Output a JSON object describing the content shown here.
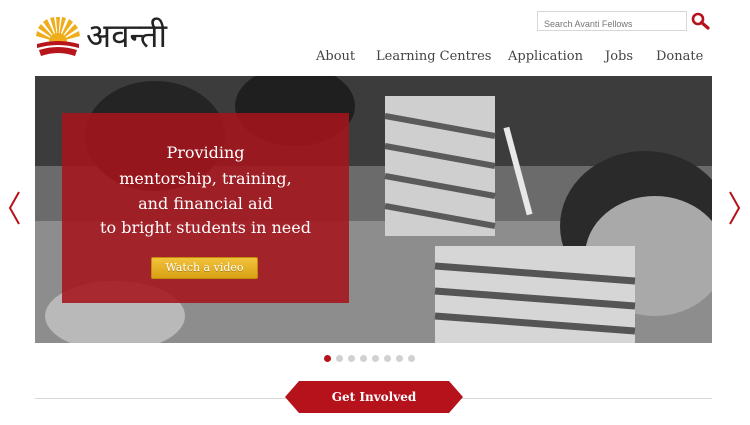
{
  "brand": {
    "name": "अवन्ती"
  },
  "search": {
    "placeholder": "Search Avanti Fellows",
    "icon": "search-icon"
  },
  "nav": {
    "items": [
      {
        "label": "About"
      },
      {
        "label": "Learning Centres"
      },
      {
        "label": "Application"
      },
      {
        "label": "Jobs"
      },
      {
        "label": "Donate"
      }
    ]
  },
  "hero": {
    "caption_lines": [
      "Providing",
      "mentorship, training,",
      "and financial aid",
      "to bright students in need"
    ],
    "cta_label": "Watch a video",
    "prev_icon": "chevron-left-icon",
    "next_icon": "chevron-right-icon"
  },
  "carousel": {
    "slide_count": 8,
    "active_index": 0
  },
  "section": {
    "label": "Get Involved"
  },
  "colors": {
    "brand_red": "#a5161c",
    "gold": "#f2c23c",
    "dot_active": "#b5121b",
    "dot_inactive": "#d1d1d1"
  }
}
